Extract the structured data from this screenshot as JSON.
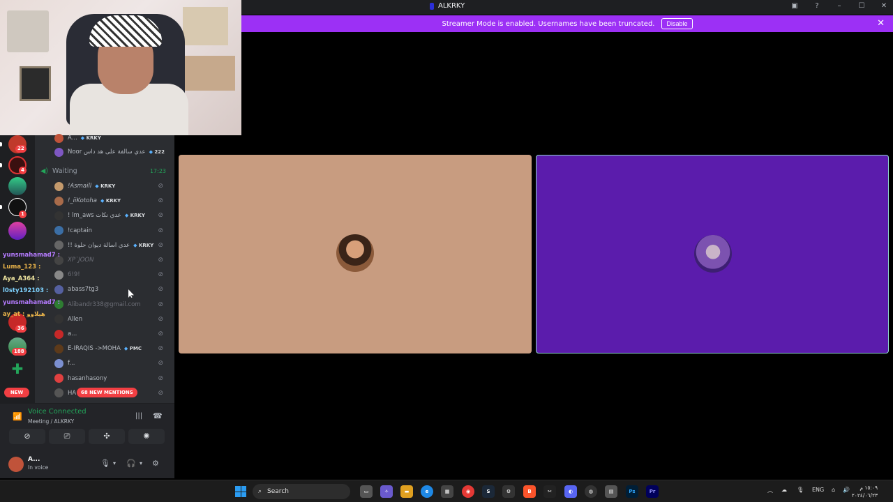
{
  "window": {
    "title": "ALKRKY",
    "icons": [
      "inbox-icon",
      "help-icon",
      "minimize-icon",
      "maximize-icon",
      "close-icon"
    ]
  },
  "banner": {
    "text": "Streamer Mode is enabled. Usernames have been truncated.",
    "button": "Disable",
    "close": "✕",
    "color": "#9c30f5"
  },
  "rail": {
    "badges": [
      "22",
      "4",
      "1",
      "36",
      "188"
    ],
    "new_label": "NEW"
  },
  "channel": {
    "top_rows": [
      {
        "name": "A...",
        "tag": "KRKY"
      },
      {
        "name": "Noor عدي سالفة على هد داس",
        "tag": "222"
      }
    ],
    "waiting": {
      "label": "Waiting",
      "time": "17:23"
    },
    "members": [
      {
        "name": "!Asmaill",
        "tag": "KRKY",
        "italic": true
      },
      {
        "name": "!_iiKotoha",
        "tag": "KRKY",
        "italic": true
      },
      {
        "name": "! lm_aws عدي نكات",
        "tag": "KRKY"
      },
      {
        "name": "!captain"
      },
      {
        "name": "!! عدي اسالة ديوان حلوة",
        "tag": "KRKY"
      },
      {
        "name": "XP`JOON",
        "muted": true,
        "italic": true
      },
      {
        "name": "6!9!",
        "muted": true
      },
      {
        "name": "abass7tg3"
      },
      {
        "name": "Alibandr338@gmail.com",
        "muted": true
      },
      {
        "name": "Allen"
      },
      {
        "name": "a..."
      },
      {
        "name": "E-IRAQIS ->MOHA",
        "tag": "PMC"
      },
      {
        "name": "f..."
      },
      {
        "name": "hasanhasony"
      },
      {
        "name": "HA"
      }
    ],
    "mentions": "68 NEW MENTIONS"
  },
  "chat_overlay": [
    {
      "user": "yunsmahamad7 :",
      "color": "#b57bff"
    },
    {
      "user": "Luma_123 :",
      "color": "#e8b24a"
    },
    {
      "user": "Aya_A364 :",
      "color": "#f0e6a0"
    },
    {
      "user": "l0sty192103 :",
      "color": "#7fd3ff"
    },
    {
      "user": "yunsmahamad7 :",
      "color": "#b57bff"
    },
    {
      "user": "ay_at : هيلاوو",
      "color": "#e8b24a"
    }
  ],
  "voice": {
    "status": "Voice Connected",
    "channel": "Meeting / ALKRKY",
    "buttons": [
      "camera-off-icon",
      "screen-share-icon",
      "activities-icon",
      "soundboard-icon"
    ]
  },
  "user": {
    "name": "A...",
    "status": "In voice"
  },
  "stage": {
    "tile_colors": [
      "#c89c80",
      "#5b1cac"
    ]
  },
  "taskbar": {
    "search": "Search",
    "lang": "ENG",
    "clock_time": "١٥:٠٩ م",
    "clock_date": "٢٠٢٤/٠٦/٢٣",
    "apps": [
      "Ps",
      "Pr"
    ]
  }
}
